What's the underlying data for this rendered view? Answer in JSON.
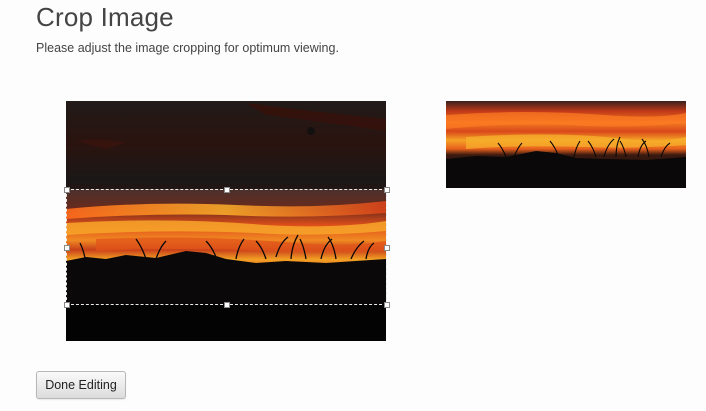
{
  "page": {
    "title": "Crop Image",
    "subtitle": "Please adjust the image cropping for optimum viewing."
  },
  "crop_editor": {
    "image_description_icon": "sunset-photo",
    "selection_handles": [
      "top-left",
      "top-center",
      "top-right",
      "middle-left",
      "middle-right",
      "bottom-left",
      "bottom-center",
      "bottom-right"
    ]
  },
  "preview": {
    "image_description_icon": "cropped-sunset-preview"
  },
  "actions": {
    "done_label": "Done Editing"
  },
  "colors": {
    "sky_dark": "#3a3634",
    "sky_mid": "#5a3a30",
    "cloud_orange": "#e8541a",
    "cloud_bright": "#f7a21a",
    "silhouette": "#0a0808"
  }
}
